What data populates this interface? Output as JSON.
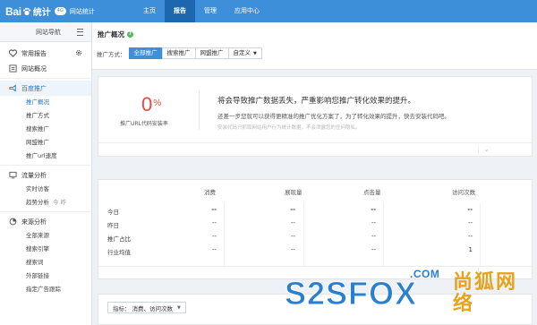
{
  "app": {
    "logo_text": "Bai",
    "logo_tongji": "统计",
    "logo_badge": "4G",
    "logo_site": "网站统计"
  },
  "topnav": [
    {
      "label": "主页",
      "active": false
    },
    {
      "label": "报告",
      "active": true
    },
    {
      "label": "管理",
      "active": false
    },
    {
      "label": "应用中心",
      "active": false
    }
  ],
  "sidebar": {
    "title": "网站导航",
    "groups": [
      {
        "label": "常用报告",
        "icon": "heart-icon"
      },
      {
        "label": "网站概况",
        "icon": "list-icon"
      },
      {
        "label": "百度推广",
        "icon": "megaphone-icon",
        "active": true,
        "items": [
          "推广概况",
          "推广方式",
          "搜索推广",
          "网盟推广",
          "推广url速度"
        ]
      },
      {
        "label": "流量分析",
        "icon": "monitor-icon",
        "items": [
          "实时访客",
          "趋势分析"
        ]
      },
      {
        "label": "来源分析",
        "icon": "source-icon",
        "items": [
          "全部来源",
          "搜索引擎",
          "搜索词",
          "外部链接",
          "指定广告跟踪"
        ]
      }
    ],
    "trend_tag": "今 昨"
  },
  "page": {
    "title": "推广概况",
    "help": "?",
    "filter_label": "推广方式：",
    "filters": [
      "全部推广",
      "搜索推广",
      "网盟推广",
      "自定义"
    ],
    "selected_filter": "全部推广"
  },
  "overview": {
    "percent": "0",
    "percent_unit": "%",
    "percent_label": "推广URL代码安装率",
    "msg_title": "将会导致推广数据丢失，严重影响您推广转化效果的提升。",
    "msg_body": "还差一步您就可以获得更精准的推广优化方案了，为了转化效果的提升，快去安装代码吧。",
    "msg_note": "安装代码只抓取网站用户行为统计数据，不会泄露您的任何隐私。"
  },
  "table": {
    "columns": [
      "消费",
      "展现量",
      "点击量",
      "访问次数"
    ],
    "rows": [
      {
        "label": "今日",
        "values": [
          "--",
          "--",
          "--",
          "--"
        ]
      },
      {
        "label": "昨日",
        "values": [
          "--",
          "--",
          "--",
          "--"
        ]
      },
      {
        "label": "推广占比",
        "values": [
          "--",
          "--",
          "--",
          "--"
        ]
      },
      {
        "label": "行业均值",
        "values": [
          "--",
          "--",
          "--",
          "1"
        ]
      }
    ]
  },
  "metric_select": {
    "label": "指标：",
    "value": "消费、访问次数"
  },
  "watermark": {
    "com": ".COM",
    "brand": "S2SFOX",
    "cn": "尚狐网络"
  },
  "colors": {
    "primary": "#3c8fd8",
    "nav_active": "#1c67ae",
    "percent": "#e94a3c",
    "watermark_blue": "#2a7fcf",
    "watermark_orange": "#e8a31d"
  }
}
